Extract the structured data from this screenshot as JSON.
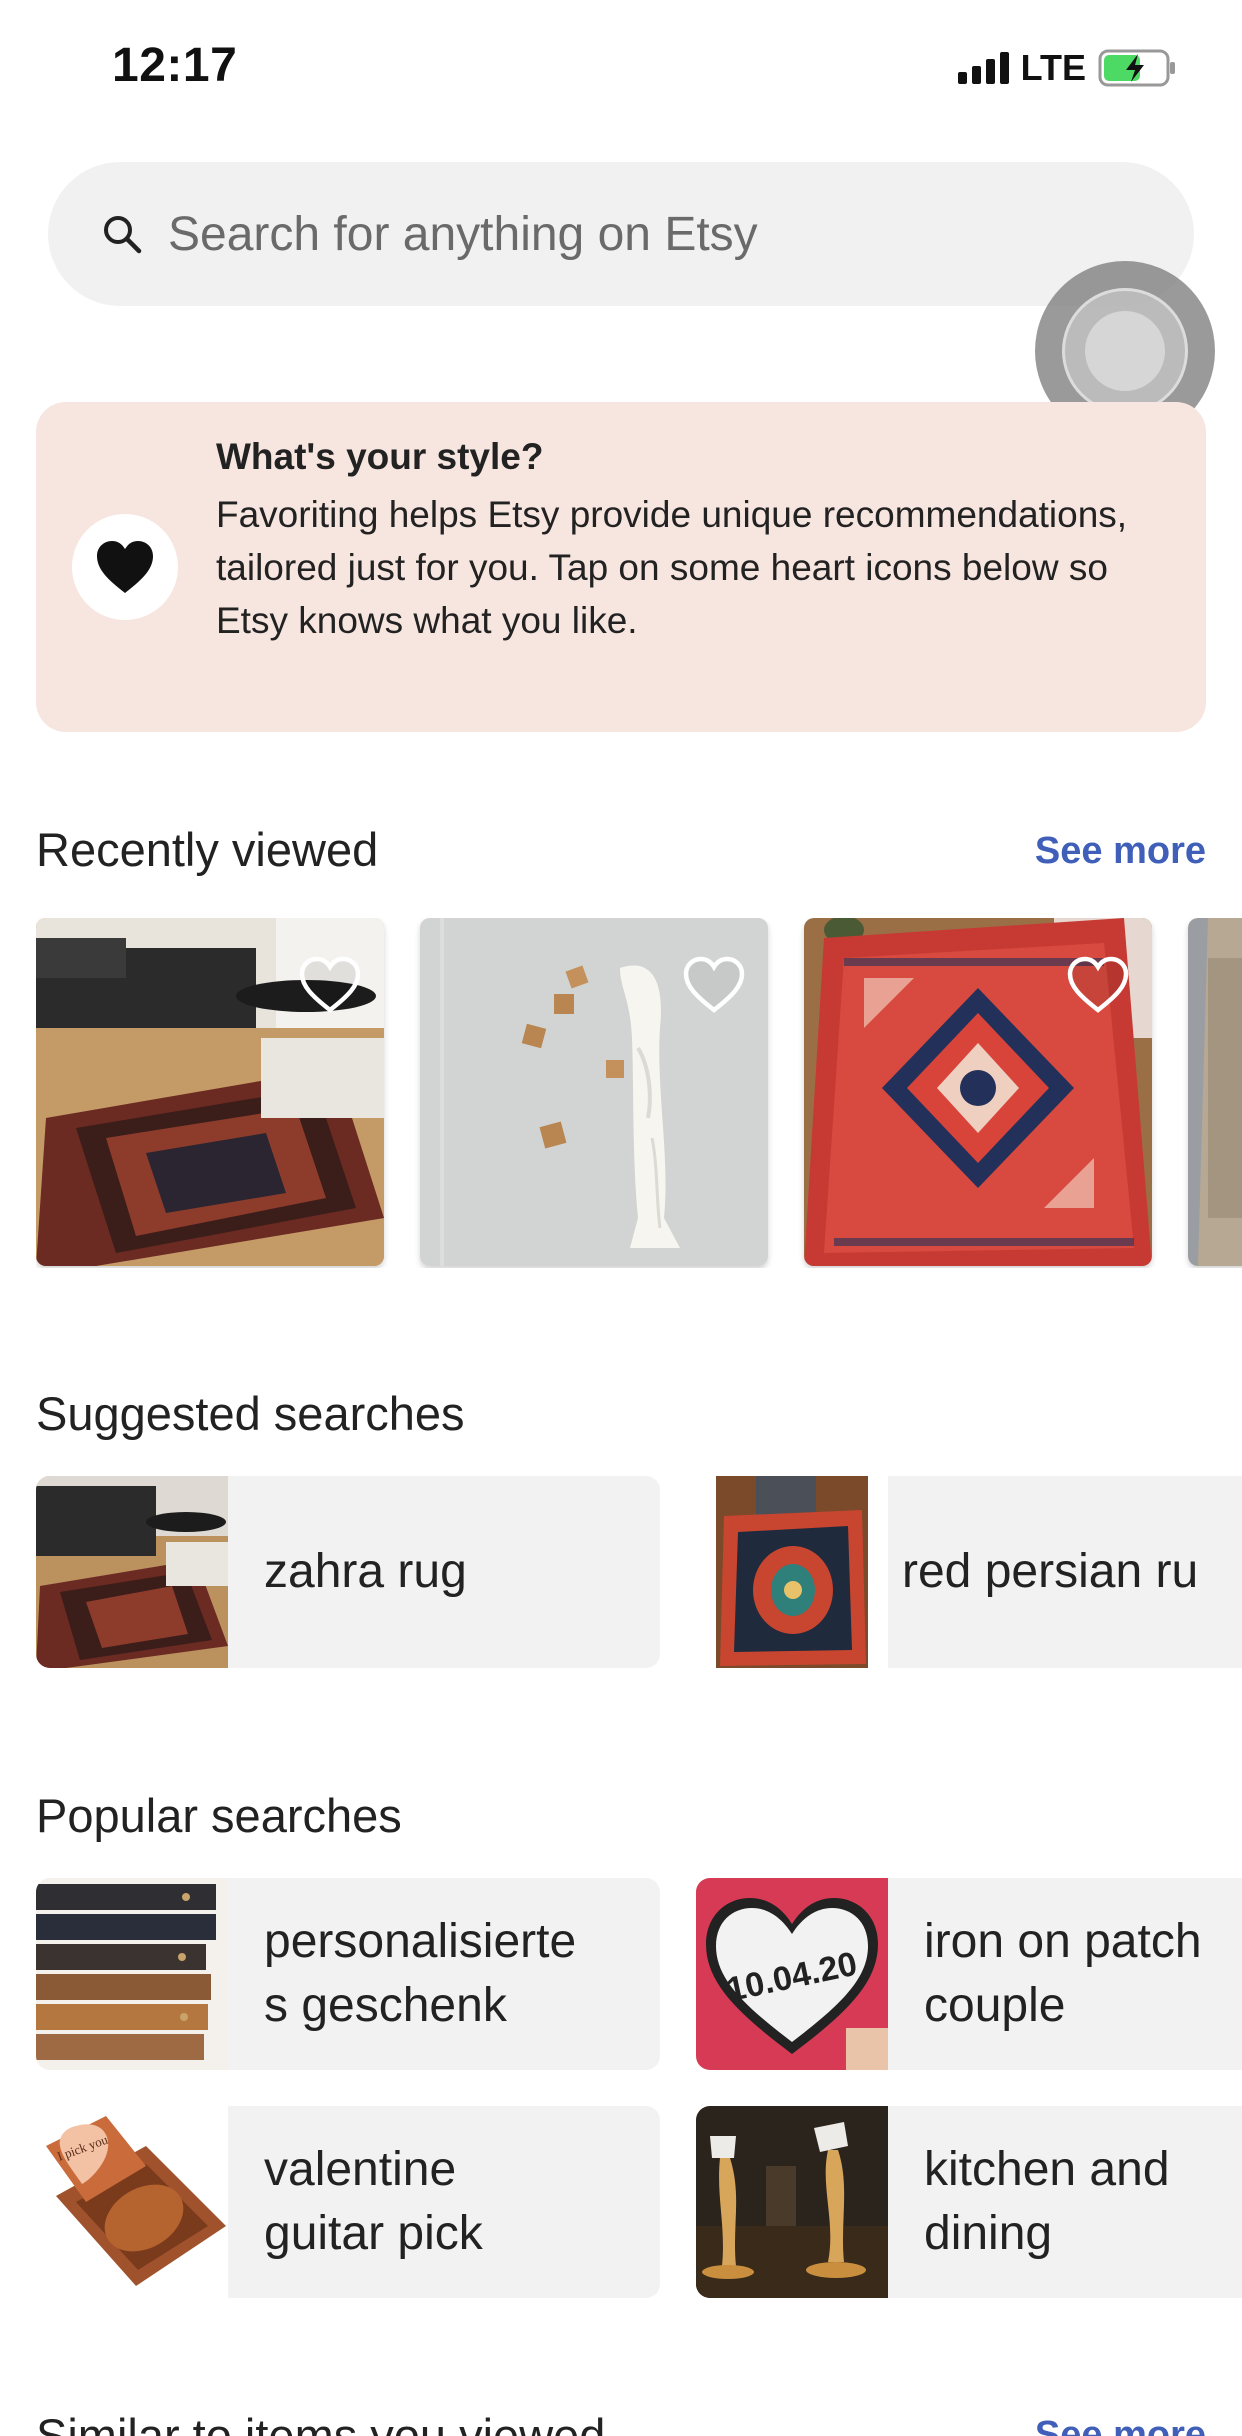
{
  "status_bar": {
    "time": "12:17",
    "network": "LTE"
  },
  "search": {
    "placeholder": "Search for anything on Etsy"
  },
  "style_card": {
    "title": "What's your style?",
    "body": "Favoriting helps Etsy provide unique recommendations, tailored just for you. Tap on some heart icons below so Etsy knows what you like."
  },
  "recently_viewed": {
    "title": "Recently viewed",
    "see_more": "See more",
    "items": [
      {
        "image": "dark persian rug in living room"
      },
      {
        "image": "white scarf on wooden wall pegs"
      },
      {
        "image": "red persian rug"
      },
      {
        "image": "rug (partially visible)"
      }
    ]
  },
  "suggested_searches": {
    "title": "Suggested searches",
    "items": [
      {
        "label": "zahra rug"
      },
      {
        "label": "red persian ru"
      }
    ]
  },
  "popular_searches": {
    "title": "Popular searches",
    "items": [
      {
        "label": "personalisierte\ns geschenk"
      },
      {
        "label": "iron on patch\ncouple",
        "patch_text": "10.04.20"
      },
      {
        "label": "valentine\nguitar pick",
        "pick_text": "I pick you"
      },
      {
        "label": "kitchen and\ndining"
      }
    ]
  },
  "similar": {
    "title": "Similar to items you viewed",
    "see_more": "See more"
  },
  "colors": {
    "accent_link": "#3f5fb8",
    "card_bg": "#f7e5df",
    "tile_bg": "#f2f2f2"
  }
}
